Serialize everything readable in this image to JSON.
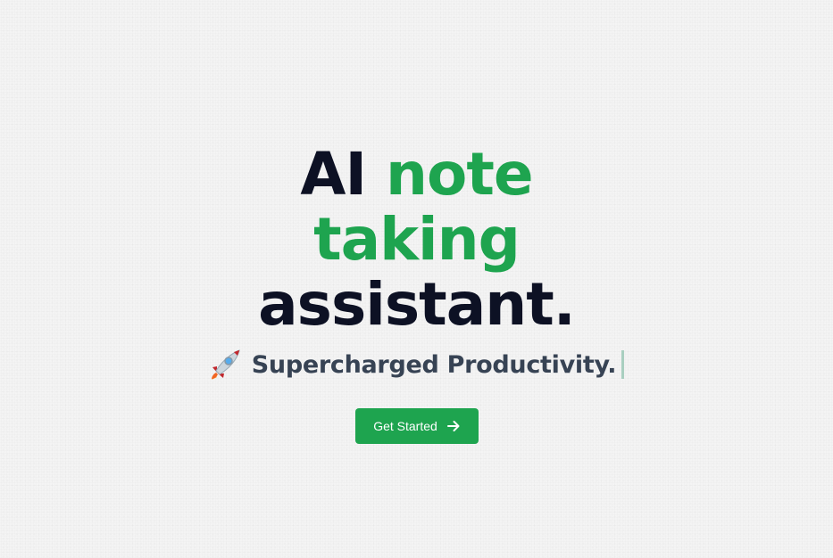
{
  "hero": {
    "headline": {
      "line1_plain": "AI ",
      "line1_accent": "note",
      "line2_accent": "taking",
      "line3_plain": "assistant."
    },
    "tagline": "Supercharged Productivity.",
    "cta_label": "Get Started",
    "tagline_icon": "rocket-icon",
    "cta_icon": "arrow-right-icon"
  },
  "colors": {
    "background": "#f4f4f4",
    "headline": "#0d1124",
    "accent": "#1ea44f",
    "tagline": "#374354",
    "button_bg": "#1ea44f",
    "button_text": "#ffffff"
  }
}
